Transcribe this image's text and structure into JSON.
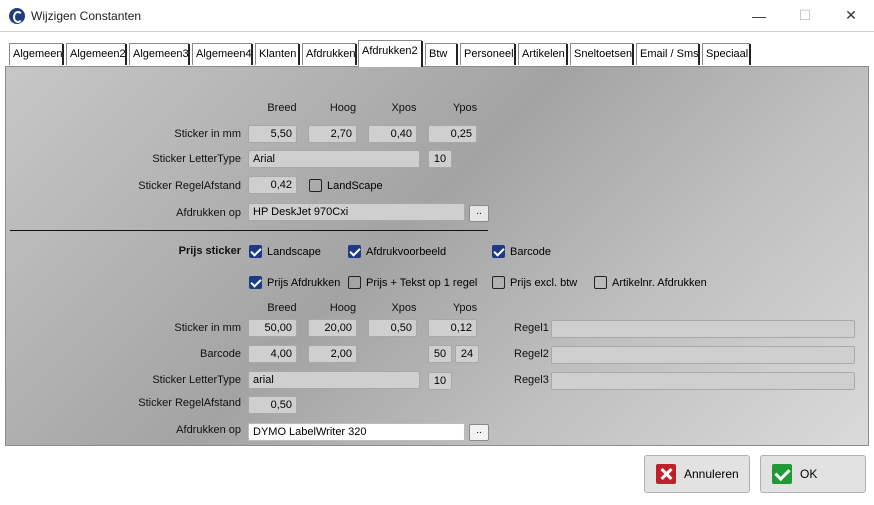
{
  "window": {
    "title": "Wijzigen Constanten",
    "minimize_glyph": "—",
    "maximize_glyph": "☐",
    "close_glyph": "✕"
  },
  "tabs": [
    "Algemeen",
    "Algemeen2",
    "Algemeen3",
    "Algemeen4",
    "Klanten",
    "Afdrukken",
    "Afdrukken2",
    "Btw",
    "Personeel",
    "Artikelen",
    "Sneltoetsen",
    "Email / Sms",
    "Speciaal"
  ],
  "active_tab": "Afdrukken2",
  "top": {
    "col_breed": "Breed",
    "col_hoog": "Hoog",
    "col_xpos": "Xpos",
    "col_ypos": "Ypos",
    "sticker_mm_label": "Sticker in mm",
    "breed": "5,50",
    "hoog": "2,70",
    "xpos": "0,40",
    "ypos": "0,25",
    "lettertype_label": "Sticker LetterType",
    "lettertype": "Arial",
    "lettersize": "10",
    "regelafstand_label": "Sticker RegelAfstand",
    "regelafstand": "0,42",
    "landscape_label": "LandScape",
    "landscape_checked": false,
    "printer_label": "Afdrukken op",
    "printer": "HP DeskJet 970Cxi",
    "browse": ".."
  },
  "prijs": {
    "section_label": "Prijs sticker",
    "landscape": "Landscape",
    "afdrukvoorbeeld": "Afdrukvoorbeeld",
    "barcode_cb": "Barcode",
    "prijs_afdrukken": "Prijs Afdrukken",
    "prijs_tekst": "Prijs + Tekst op 1 regel",
    "prijs_excl": "Prijs excl. btw",
    "artikelnr": "Artikelnr. Afdrukken",
    "col_breed": "Breed",
    "col_hoog": "Hoog",
    "col_xpos": "Xpos",
    "col_ypos": "Ypos",
    "sticker_mm_label": "Sticker in mm",
    "breed": "50,00",
    "hoog": "20,00",
    "xpos": "0,50",
    "ypos": "0,12",
    "barcode_label": "Barcode",
    "barcode_breed": "4,00",
    "barcode_hoog": "2,00",
    "barcode_a": "50",
    "barcode_b": "24",
    "lettertype_label": "Sticker LetterType",
    "lettertype": "arial",
    "lettersize": "10",
    "regelafstand_label": "Sticker RegelAfstand",
    "regelafstand": "0,50",
    "printer_label": "Afdrukken op",
    "printer": "DYMO LabelWriter 320",
    "browse": "..",
    "regel1_label": "Regel1",
    "regel1": "",
    "regel2_label": "Regel2",
    "regel2": "",
    "regel3_label": "Regel3",
    "regel3": ""
  },
  "buttons": {
    "cancel": "Annuleren",
    "ok": "OK"
  }
}
